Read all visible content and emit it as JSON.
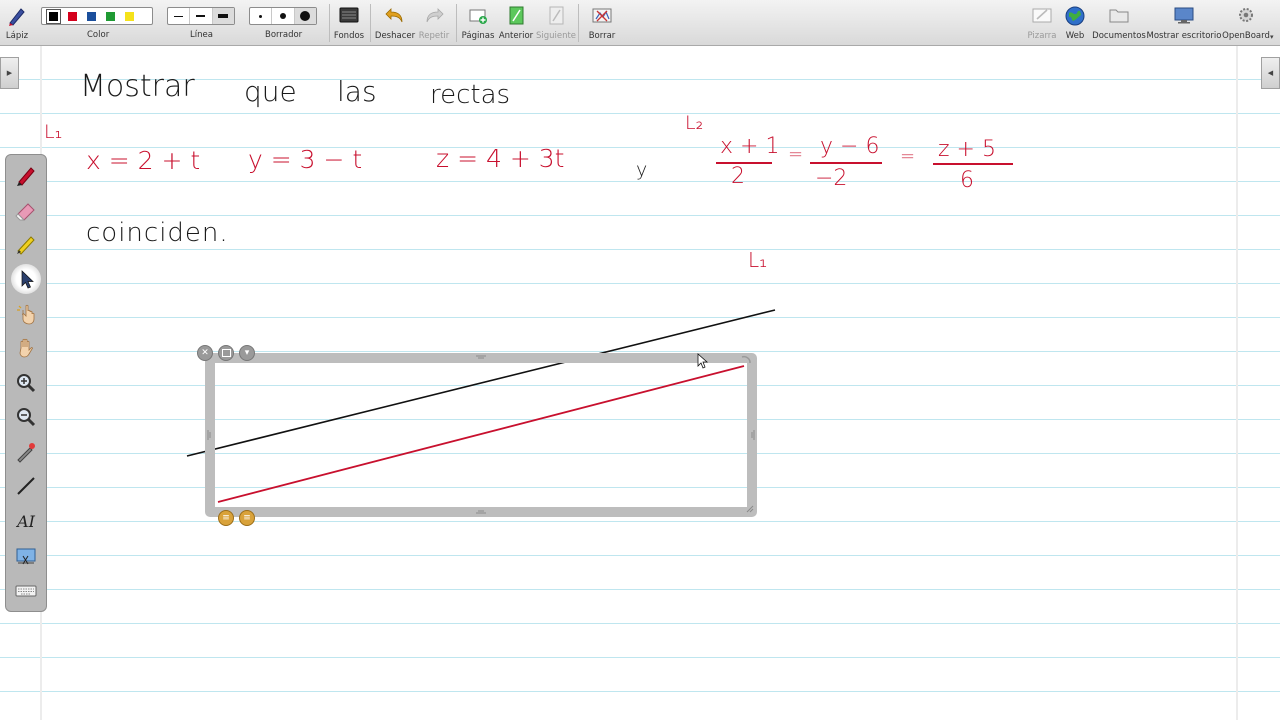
{
  "toolbar": {
    "lapiz": "Lápiz",
    "color": "Color",
    "linea": "Línea",
    "borrador": "Borrador",
    "fondos": "Fondos",
    "deshacer": "Deshacer",
    "repetir": "Repetir",
    "paginas": "Páginas",
    "anterior": "Anterior",
    "siguiente": "Siguiente",
    "borrar": "Borrar",
    "pizarra": "Pizarra",
    "web": "Web",
    "documentos": "Documentos",
    "mostrar_escritorio": "Mostrar escritorio",
    "openboard": "OpenBoard"
  },
  "colors": {
    "swatches": [
      "#000000",
      "#d4001c",
      "#1b4f9c",
      "#1f9a33",
      "#f5e21a"
    ],
    "ink_red": "#c8102e",
    "ink_black": "#1a1a1a",
    "ruling": "#bfe6ef"
  },
  "board": {
    "heading_words": [
      "Mostrar",
      "que",
      "las",
      "rectas"
    ],
    "l1_label": "L₁",
    "eq_x": "x = 2 + t",
    "eq_y": "y = 3 − t",
    "eq_z": "z = 4 + 3t",
    "conj": "y",
    "l2_label": "L₂",
    "frac1_num": "x + 1",
    "frac1_den": "2",
    "eq1": "=",
    "frac2_num": "y − 6",
    "frac2_den": "−2",
    "eq2": "=",
    "frac3_num": "z + 5",
    "frac3_den": "6",
    "coinciden": "coinciden.",
    "graph_label": "L₁"
  },
  "palette": {
    "tools": [
      "pen-icon",
      "eraser-icon",
      "marker-icon",
      "selector-icon",
      "interact-icon",
      "hand-icon",
      "zoom-in-icon",
      "zoom-out-icon",
      "laser-pointer-icon",
      "line-icon",
      "text-icon",
      "capture-icon",
      "keyboard-icon"
    ],
    "text_tool_glyph": "AI"
  }
}
